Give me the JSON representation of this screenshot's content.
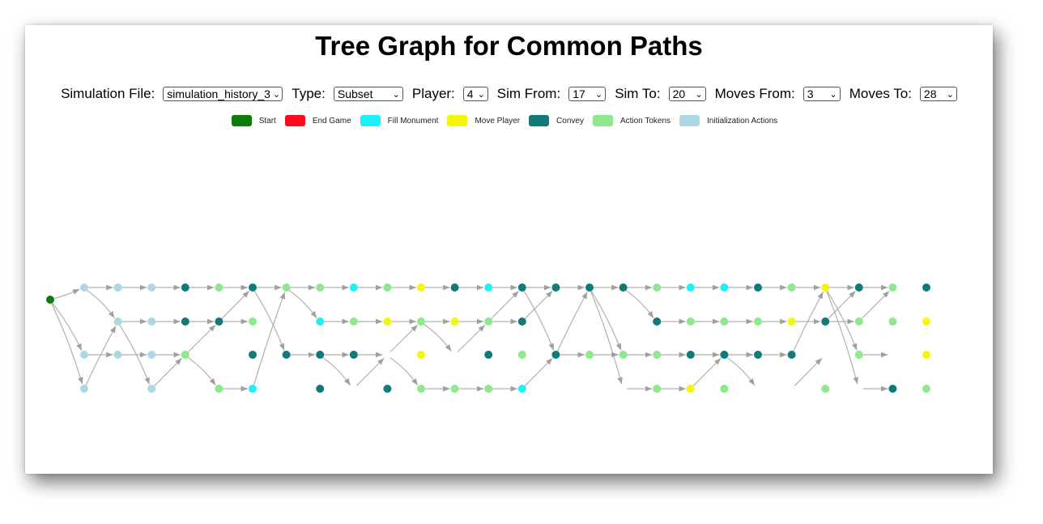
{
  "title": "Tree Graph for Common Paths",
  "controls": {
    "simulation_file": {
      "label": "Simulation File:",
      "value": "simulation_history_3"
    },
    "type": {
      "label": "Type:",
      "value": "Subset"
    },
    "player": {
      "label": "Player:",
      "value": "4"
    },
    "sim_from": {
      "label": "Sim From:",
      "value": "17"
    },
    "sim_to": {
      "label": "Sim To:",
      "value": "20"
    },
    "moves_from": {
      "label": "Moves From:",
      "value": "3"
    },
    "moves_to": {
      "label": "Moves To:",
      "value": "28"
    }
  },
  "legend": [
    {
      "key": "start",
      "label": "Start",
      "color": "#0a7d0a"
    },
    {
      "key": "end",
      "label": "End Game",
      "color": "#ff0a1e"
    },
    {
      "key": "fill",
      "label": "Fill Monument",
      "color": "#1ef0fa"
    },
    {
      "key": "move",
      "label": "Move Player",
      "color": "#f5f50a"
    },
    {
      "key": "convey",
      "label": "Convey",
      "color": "#117a7a"
    },
    {
      "key": "token",
      "label": "Action Tokens",
      "color": "#8ee88e"
    },
    {
      "key": "init",
      "label": "Initialization Actions",
      "color": "#acd8e6"
    }
  ],
  "chart_data": {
    "type": "tree",
    "node_types": {
      "S": "start",
      "I": "init",
      "C": "convey",
      "T": "token",
      "F": "fill",
      "M": "move"
    },
    "rows": [
      "-IIICTCTTFTMCFCCCCTFFCTMCTC",
      "--IICCT-FTMTMTC---CTTTMCTTM",
      "-IIIT-CCCC-M-CTCTTTCCCC-T-M",
      "-I-I-TF-C-CTTTF---TMT--T-CT"
    ],
    "edges": [
      [
        [
          0,
          0
        ],
        [
          1,
          0
        ]
      ],
      [
        [
          0,
          0
        ],
        [
          1,
          2
        ]
      ],
      [
        [
          0,
          0
        ],
        [
          1,
          3
        ]
      ],
      [
        [
          1,
          0
        ],
        [
          2,
          0
        ]
      ],
      [
        [
          1,
          0
        ],
        [
          2,
          1
        ]
      ],
      [
        [
          1,
          2
        ],
        [
          2,
          2
        ]
      ],
      [
        [
          1,
          3
        ],
        [
          2,
          1
        ]
      ],
      [
        [
          2,
          0
        ],
        [
          3,
          0
        ]
      ],
      [
        [
          2,
          1
        ],
        [
          3,
          1
        ]
      ],
      [
        [
          2,
          1
        ],
        [
          3,
          3
        ]
      ],
      [
        [
          2,
          2
        ],
        [
          3,
          2
        ]
      ],
      [
        [
          3,
          0
        ],
        [
          4,
          0
        ]
      ],
      [
        [
          3,
          1
        ],
        [
          4,
          1
        ]
      ],
      [
        [
          3,
          2
        ],
        [
          4,
          2
        ]
      ],
      [
        [
          3,
          3
        ],
        [
          4,
          2
        ]
      ],
      [
        [
          4,
          0
        ],
        [
          5,
          0
        ]
      ],
      [
        [
          4,
          1
        ],
        [
          5,
          1
        ]
      ],
      [
        [
          4,
          2
        ],
        [
          5,
          1
        ]
      ],
      [
        [
          4,
          2
        ],
        [
          5,
          3
        ]
      ],
      [
        [
          5,
          0
        ],
        [
          6,
          0
        ]
      ],
      [
        [
          5,
          1
        ],
        [
          6,
          0
        ]
      ],
      [
        [
          5,
          1
        ],
        [
          6,
          1
        ]
      ],
      [
        [
          5,
          3
        ],
        [
          6,
          3
        ]
      ],
      [
        [
          6,
          0
        ],
        [
          7,
          0
        ]
      ],
      [
        [
          6,
          0
        ],
        [
          7,
          2
        ]
      ],
      [
        [
          6,
          3
        ],
        [
          7,
          0
        ]
      ],
      [
        [
          7,
          0
        ],
        [
          8,
          0
        ]
      ],
      [
        [
          7,
          0
        ],
        [
          8,
          1
        ]
      ],
      [
        [
          7,
          2
        ],
        [
          8,
          2
        ]
      ],
      [
        [
          8,
          0
        ],
        [
          9,
          0
        ]
      ],
      [
        [
          8,
          1
        ],
        [
          9,
          1
        ]
      ],
      [
        [
          8,
          2
        ],
        [
          9,
          2
        ]
      ],
      [
        [
          8,
          2
        ],
        [
          9,
          3
        ]
      ],
      [
        [
          9,
          0
        ],
        [
          10,
          0
        ]
      ],
      [
        [
          9,
          1
        ],
        [
          10,
          1
        ]
      ],
      [
        [
          9,
          2
        ],
        [
          10,
          2
        ]
      ],
      [
        [
          9,
          3
        ],
        [
          10,
          2
        ]
      ],
      [
        [
          10,
          0
        ],
        [
          11,
          0
        ]
      ],
      [
        [
          10,
          1
        ],
        [
          11,
          1
        ]
      ],
      [
        [
          10,
          2
        ],
        [
          11,
          1
        ]
      ],
      [
        [
          10,
          2
        ],
        [
          11,
          3
        ]
      ],
      [
        [
          11,
          0
        ],
        [
          12,
          0
        ]
      ],
      [
        [
          11,
          1
        ],
        [
          12,
          1
        ]
      ],
      [
        [
          11,
          1
        ],
        [
          12,
          2
        ]
      ],
      [
        [
          11,
          3
        ],
        [
          12,
          3
        ]
      ],
      [
        [
          12,
          0
        ],
        [
          13,
          0
        ]
      ],
      [
        [
          12,
          1
        ],
        [
          13,
          1
        ]
      ],
      [
        [
          12,
          2
        ],
        [
          13,
          1
        ]
      ],
      [
        [
          12,
          3
        ],
        [
          13,
          3
        ]
      ],
      [
        [
          13,
          0
        ],
        [
          14,
          0
        ]
      ],
      [
        [
          13,
          1
        ],
        [
          14,
          0
        ]
      ],
      [
        [
          13,
          1
        ],
        [
          14,
          1
        ]
      ],
      [
        [
          13,
          3
        ],
        [
          14,
          3
        ]
      ],
      [
        [
          14,
          0
        ],
        [
          15,
          0
        ]
      ],
      [
        [
          14,
          0
        ],
        [
          15,
          2
        ]
      ],
      [
        [
          14,
          1
        ],
        [
          15,
          0
        ]
      ],
      [
        [
          14,
          3
        ],
        [
          15,
          2
        ]
      ],
      [
        [
          15,
          0
        ],
        [
          16,
          0
        ]
      ],
      [
        [
          15,
          2
        ],
        [
          16,
          0
        ]
      ],
      [
        [
          15,
          2
        ],
        [
          16,
          2
        ]
      ],
      [
        [
          16,
          0
        ],
        [
          17,
          0
        ]
      ],
      [
        [
          16,
          0
        ],
        [
          17,
          2
        ]
      ],
      [
        [
          16,
          0
        ],
        [
          17,
          3
        ]
      ],
      [
        [
          16,
          2
        ],
        [
          17,
          2
        ]
      ],
      [
        [
          17,
          0
        ],
        [
          18,
          0
        ]
      ],
      [
        [
          17,
          0
        ],
        [
          18,
          1
        ]
      ],
      [
        [
          17,
          2
        ],
        [
          18,
          2
        ]
      ],
      [
        [
          17,
          3
        ],
        [
          18,
          3
        ]
      ],
      [
        [
          18,
          0
        ],
        [
          19,
          0
        ]
      ],
      [
        [
          18,
          1
        ],
        [
          19,
          1
        ]
      ],
      [
        [
          18,
          2
        ],
        [
          19,
          2
        ]
      ],
      [
        [
          18,
          3
        ],
        [
          19,
          3
        ]
      ],
      [
        [
          19,
          0
        ],
        [
          20,
          0
        ]
      ],
      [
        [
          19,
          1
        ],
        [
          20,
          1
        ]
      ],
      [
        [
          19,
          2
        ],
        [
          20,
          2
        ]
      ],
      [
        [
          19,
          3
        ],
        [
          20,
          2
        ]
      ],
      [
        [
          20,
          0
        ],
        [
          21,
          0
        ]
      ],
      [
        [
          20,
          1
        ],
        [
          21,
          1
        ]
      ],
      [
        [
          20,
          2
        ],
        [
          21,
          2
        ]
      ],
      [
        [
          20,
          2
        ],
        [
          21,
          3
        ]
      ],
      [
        [
          21,
          0
        ],
        [
          22,
          0
        ]
      ],
      [
        [
          21,
          1
        ],
        [
          22,
          1
        ]
      ],
      [
        [
          21,
          2
        ],
        [
          22,
          2
        ]
      ],
      [
        [
          22,
          0
        ],
        [
          23,
          0
        ]
      ],
      [
        [
          22,
          1
        ],
        [
          23,
          1
        ]
      ],
      [
        [
          22,
          2
        ],
        [
          23,
          0
        ]
      ],
      [
        [
          22,
          3
        ],
        [
          23,
          2
        ]
      ],
      [
        [
          23,
          0
        ],
        [
          24,
          0
        ]
      ],
      [
        [
          23,
          0
        ],
        [
          24,
          2
        ]
      ],
      [
        [
          23,
          0
        ],
        [
          24,
          3
        ]
      ],
      [
        [
          23,
          1
        ],
        [
          24,
          1
        ]
      ],
      [
        [
          23,
          1
        ],
        [
          24,
          0
        ]
      ],
      [
        [
          24,
          0
        ],
        [
          25,
          0
        ]
      ],
      [
        [
          24,
          1
        ],
        [
          25,
          0
        ]
      ],
      [
        [
          24,
          2
        ],
        [
          25,
          2
        ]
      ],
      [
        [
          24,
          3
        ],
        [
          25,
          3
        ]
      ]
    ]
  }
}
